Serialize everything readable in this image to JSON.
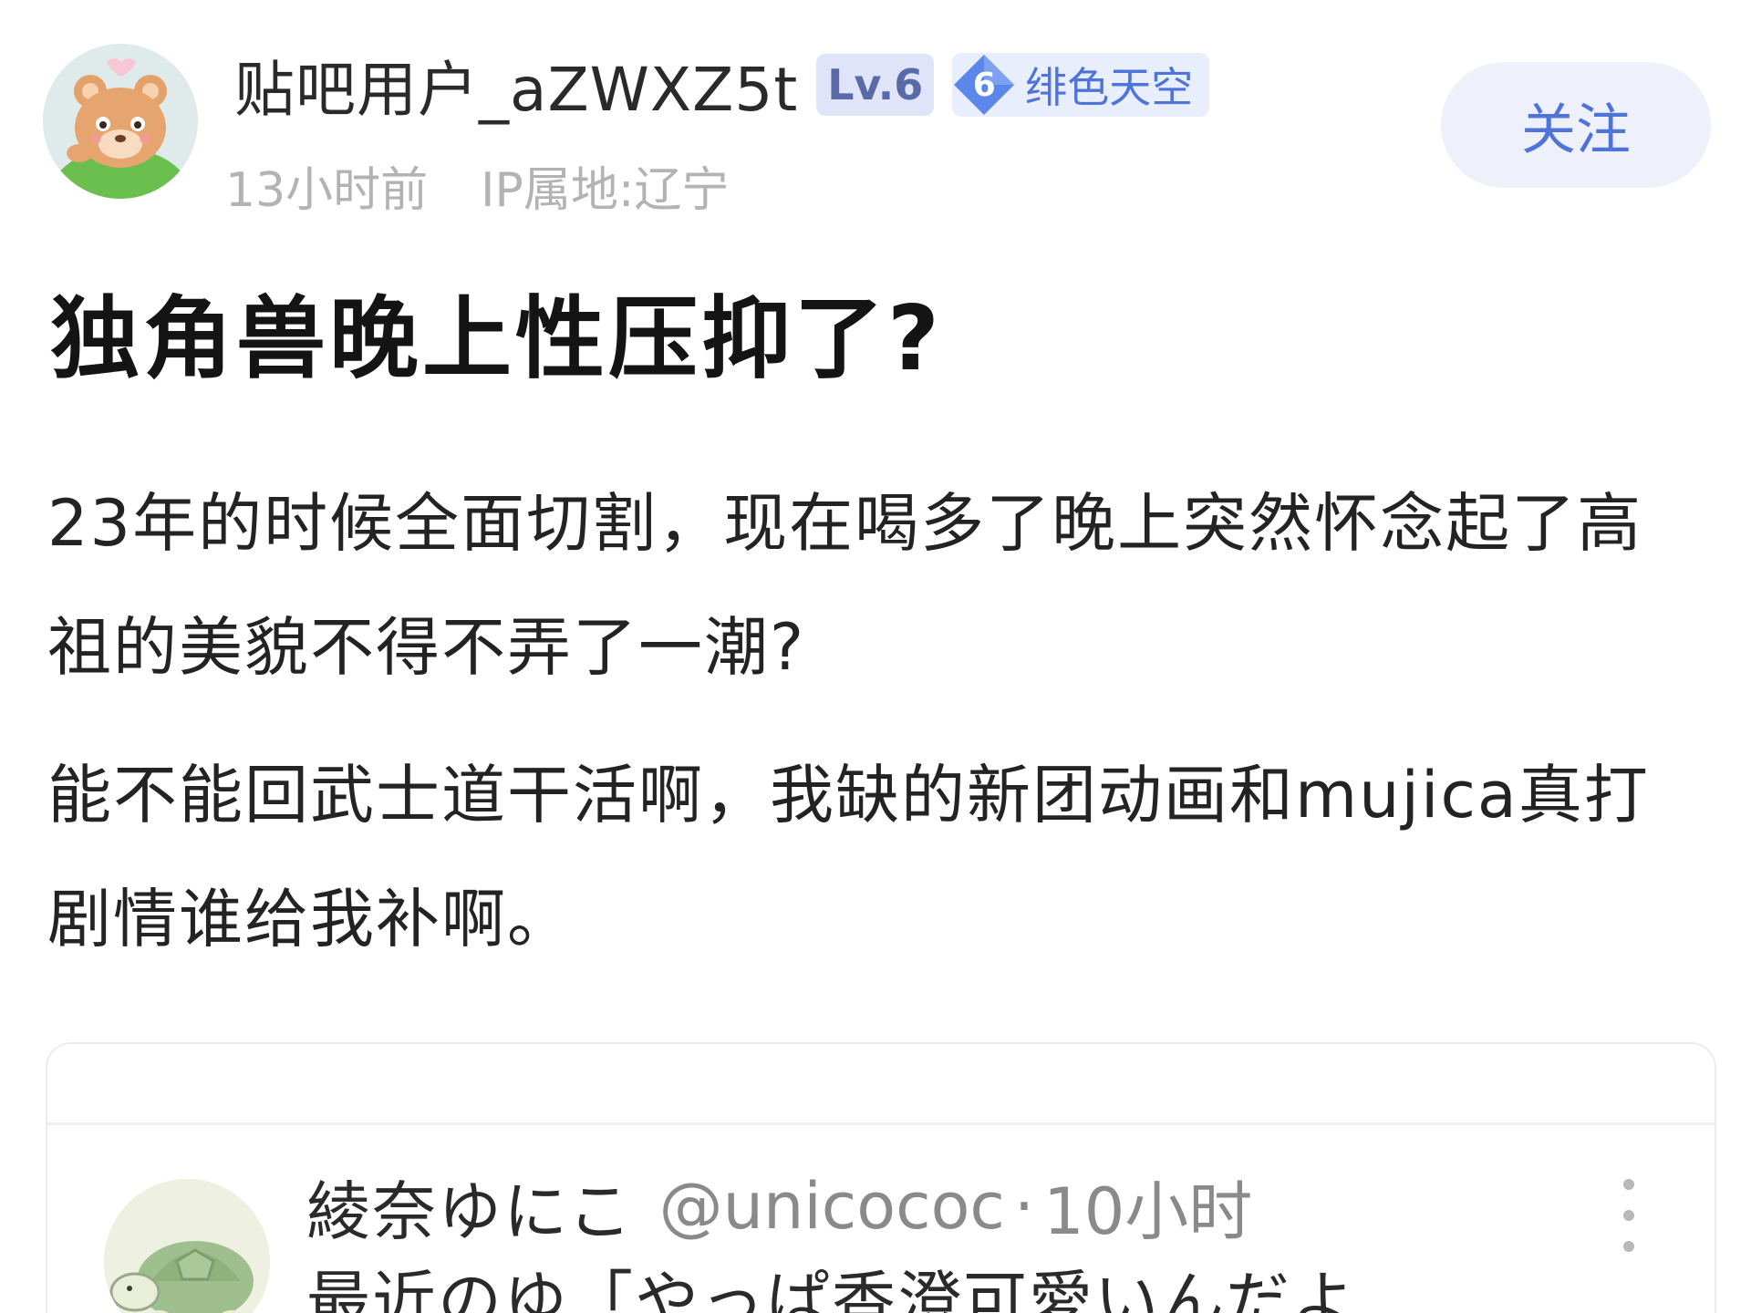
{
  "post": {
    "author": {
      "username": "贴吧用户_aZWXZ5t",
      "level": "Lv.6",
      "title_badge_number": "6",
      "title_badge_text": "绯色天空",
      "avatar": "bear-avatar-icon"
    },
    "time": "13小时前",
    "ip_location": "IP属地:辽宁",
    "follow_label": "关注",
    "title": "独角兽晚上性压抑了?",
    "paragraphs": [
      "23年的时候全面切割，现在喝多了晚上突然怀念起了高祖的美貌不得不弄了一潮?",
      "能不能回武士道干活啊，我缺的新团动画和mujica真打剧情谁给我补啊。"
    ]
  },
  "embed": {
    "name": "綾奈ゆにこ",
    "handle": "@unicococ",
    "separator": "·",
    "time": "10小时",
    "text": "最近のゆ「やっぱ香澄可愛いんだよ",
    "avatar": "turtle-avatar-icon",
    "more": "more-vertical-icon"
  },
  "colors": {
    "accent": "#4f74d9",
    "level_badge_bg": "#dfe4f8",
    "follow_bg": "#eef1fb",
    "meta_text": "#b3b3b3"
  }
}
